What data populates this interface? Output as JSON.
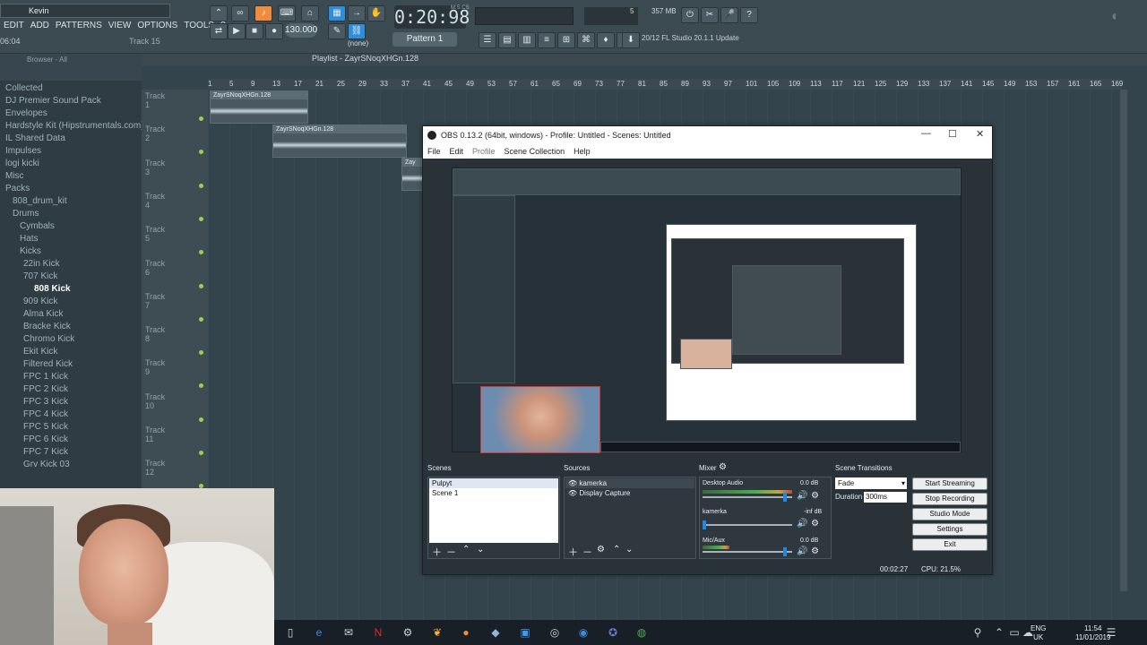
{
  "fl": {
    "user": "Kevin",
    "menu": [
      "EDIT",
      "ADD",
      "PATTERNS",
      "VIEW",
      "OPTIONS",
      "TOOLS",
      "?"
    ],
    "hint_time": "06:04",
    "hint_track": "Track 15",
    "time": "0:20:98",
    "time_unit": "M:S:CS",
    "tempo": "130.000",
    "pattern": "Pattern 1",
    "none_label": "(none)",
    "news": "20/12  FL Studio 20.1.1 Update",
    "mem": "357 MB",
    "cpu_count": "5",
    "browser_title": "Browser - All",
    "browser_items": [
      "Collected",
      "DJ Premier Sound Pack",
      "Envelopes",
      "Hardstyle Kit (Hipstrumentals.com)",
      "IL Shared Data",
      "Impulses",
      "logi kicki",
      "Misc",
      "Packs",
      "808_drum_kit",
      "Drums",
      "Cymbals",
      "Hats",
      "Kicks",
      "22in Kick",
      "707 Kick",
      "808 Kick",
      "909 Kick",
      "Alma Kick",
      "Bracke Kick",
      "Chromo Kick",
      "Ekit Kick",
      "Filtered Kick",
      "FPC 1 Kick",
      "FPC 2 Kick",
      "FPC 3 Kick",
      "FPC 4 Kick",
      "FPC 5 Kick",
      "FPC 6 Kick",
      "FPC 7 Kick",
      "Grv Kick 03"
    ],
    "playlist_title": "Playlist - ZayrSNoqXHGn.128",
    "ruler": [
      "1",
      "5",
      "9",
      "13",
      "17",
      "21",
      "25",
      "29",
      "33",
      "37",
      "41",
      "45",
      "49",
      "53",
      "57",
      "61",
      "65",
      "69",
      "73",
      "77",
      "81",
      "85",
      "89",
      "93",
      "97",
      "101",
      "105",
      "109",
      "113",
      "117",
      "121",
      "125",
      "129",
      "133",
      "137",
      "141",
      "145",
      "149",
      "153",
      "157",
      "161",
      "165",
      "169"
    ],
    "tracks": [
      "Track 1",
      "Track 2",
      "Track 3",
      "Track 4",
      "Track 5",
      "Track 6",
      "Track 7",
      "Track 8",
      "Track 9",
      "Track 10",
      "Track 11",
      "Track 12"
    ],
    "clip_name": "ZayrSNoqXHGn.128",
    "clip_name_short": "Zay"
  },
  "obs": {
    "title": "OBS 0.13.2 (64bit, windows) - Profile: Untitled - Scenes: Untitled",
    "menu": [
      "File",
      "Edit",
      "Profile",
      "Scene Collection",
      "Help"
    ],
    "scenes_label": "Scenes",
    "scenes": [
      "Pulpyt",
      "Scene 1"
    ],
    "sources_label": "Sources",
    "sources": [
      "kamerka",
      "Display Capture"
    ],
    "mixer_label": "Mixer",
    "mixer": [
      {
        "name": "Desktop Audio",
        "db": "0.0 dB",
        "level": 0.85
      },
      {
        "name": "kamerka",
        "db": "-inf dB",
        "level": 0.0
      },
      {
        "name": "Mic/Aux",
        "db": "0.0 dB",
        "level": 0.85
      }
    ],
    "transitions_label": "Scene Transitions",
    "transition": "Fade",
    "duration_label": "Duration",
    "duration": "300ms",
    "buttons": [
      "Start Streaming",
      "Stop Recording",
      "Studio Mode",
      "Settings",
      "Exit"
    ],
    "rec_time": "00:02:27",
    "cpu": "CPU: 21.5%"
  },
  "taskbar": {
    "lang": "ENG",
    "lang2": "UK",
    "time": "11:54",
    "date": "11/01/2019"
  },
  "colors": {
    "obs_bg": "#293139",
    "fl_bg": "#34444d",
    "accent": "#f28a3c"
  }
}
